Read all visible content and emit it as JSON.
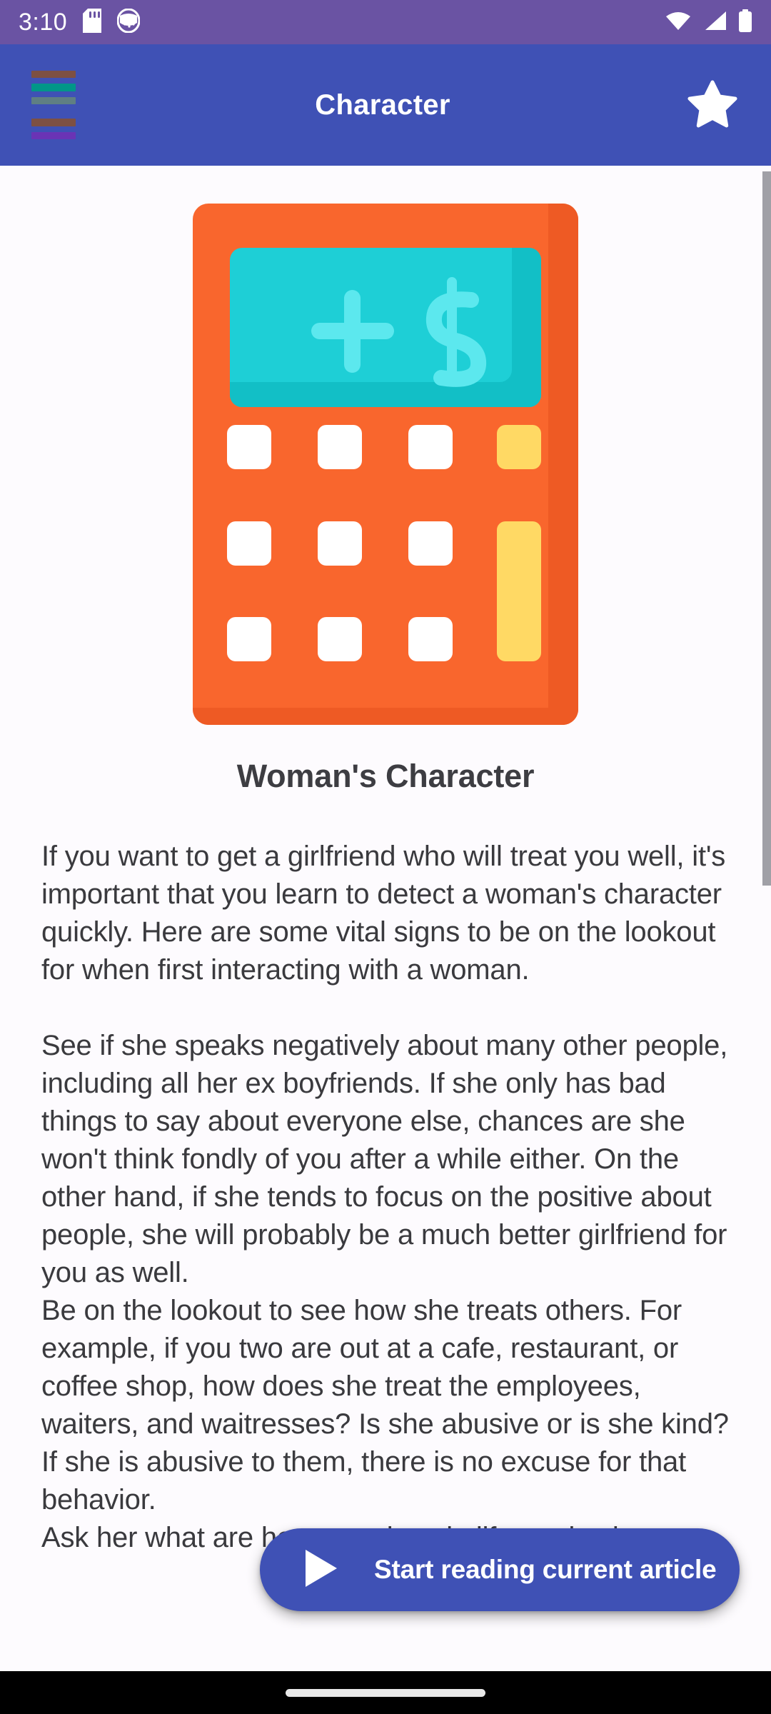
{
  "status_bar": {
    "time": "3:10",
    "icons": [
      "sd-card-icon",
      "app-notification-icon"
    ],
    "right_icons": [
      "wifi-icon",
      "cellular-signal-icon",
      "battery-icon"
    ],
    "background_color": "#6a53a3"
  },
  "app_bar": {
    "title": "Character",
    "menu_icon": "hamburger-menu-icon",
    "favorite_icon": "star-filled-icon",
    "background_color": "#3f51b5",
    "hamburger_bar_colors": [
      "#7d5043",
      "#009688",
      "#5f7f83",
      "#7d5043",
      "#6a34b5"
    ]
  },
  "article": {
    "image_name": "calculator-illustration",
    "image_colors": {
      "body": "#f9662d",
      "body_shade": "#ef5c26",
      "screen": "#1ecfd6",
      "screen_shade": "#12c2c9",
      "symbols": "#5ce8ee",
      "key": "#ffffff",
      "key_accent": "#ffd964"
    },
    "title": "Woman's Character",
    "paragraphs": [
      "If you want to get a girlfriend who will treat you well, it's important that you learn to detect a woman's character quickly.  Here are some vital signs to be on the lookout for when first interacting with a woman.",
      " See if she speaks negatively about many other people, including all her ex boyfriends.  If she only has bad things to say about everyone else, chances are she won't think fondly of you after a while either.  On the other hand, if she tends to focus on the positive about people, she will probably be a much better girlfriend for you as well.\nBe on the lookout to see how she treats others.  For example, if you two are out at a cafe, restaurant, or coffee shop, how does she treat the employees, waiters, and waitresses?  Is she abusive or is she kind?  If she is abusive to them, there is no excuse for that behavior.\nAsk her what are her top values in life, and ask"
    ]
  },
  "floating_action": {
    "label": "Start reading current article",
    "icon": "play-triangle-icon",
    "background_color": "#3f51b5"
  },
  "scrollbar": {
    "name": "vertical-scrollbar",
    "thumb_color": "#a0a0a6"
  },
  "nav_bar": {
    "handle_name": "gesture-home-handle",
    "background_color": "#000000"
  }
}
